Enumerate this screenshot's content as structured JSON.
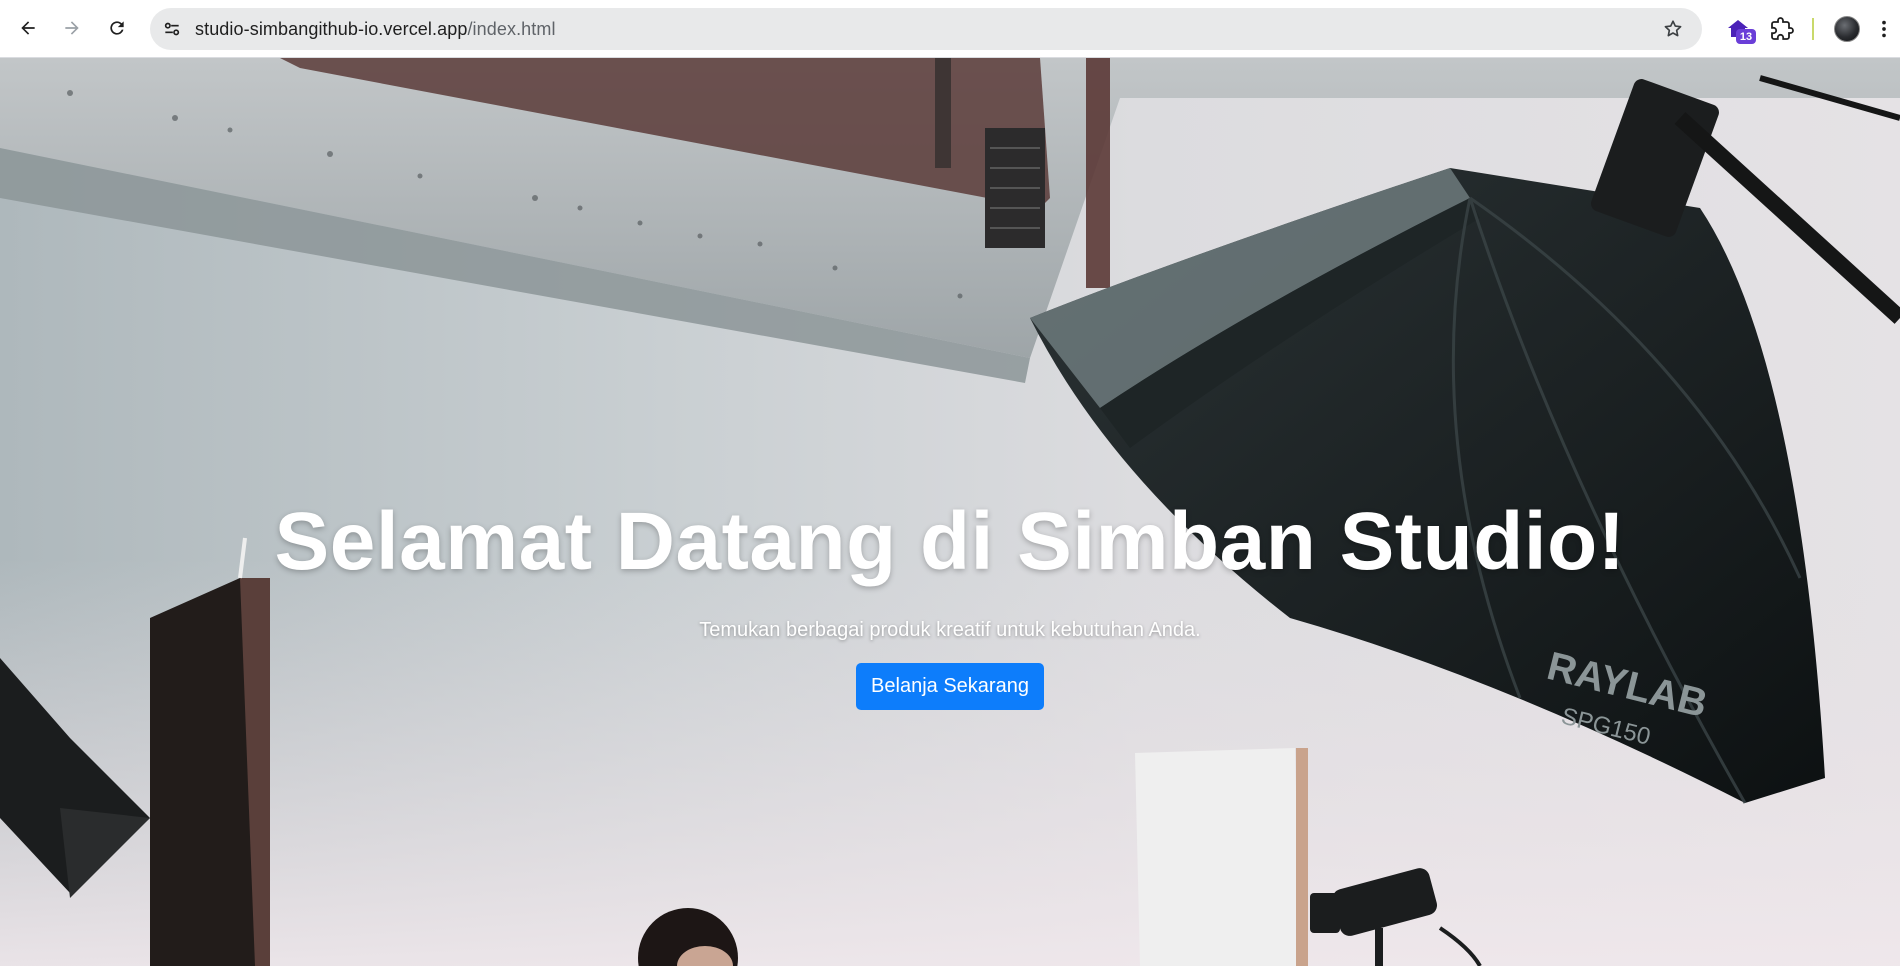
{
  "browser": {
    "url_host": "studio-simbangithub-io.vercel.app",
    "url_path": "/index.html",
    "extension_badge": "13"
  },
  "hero": {
    "title": "Selamat Datang di Simban Studio!",
    "subtitle": "Temukan berbagai produk kreatif untuk kebutuhan Anda.",
    "cta_label": "Belanja Sekarang",
    "brand_text": "RAYLAB",
    "model_text": "SPG150"
  },
  "colors": {
    "cta": "#0d7dfb",
    "badge": "#6a3ed8"
  },
  "icons": [
    "back-arrow-icon",
    "forward-arrow-icon",
    "reload-icon",
    "site-settings-icon",
    "bookmark-star-icon",
    "extension-house-icon",
    "puzzle-icon",
    "avatar",
    "more-menu-icon"
  ]
}
